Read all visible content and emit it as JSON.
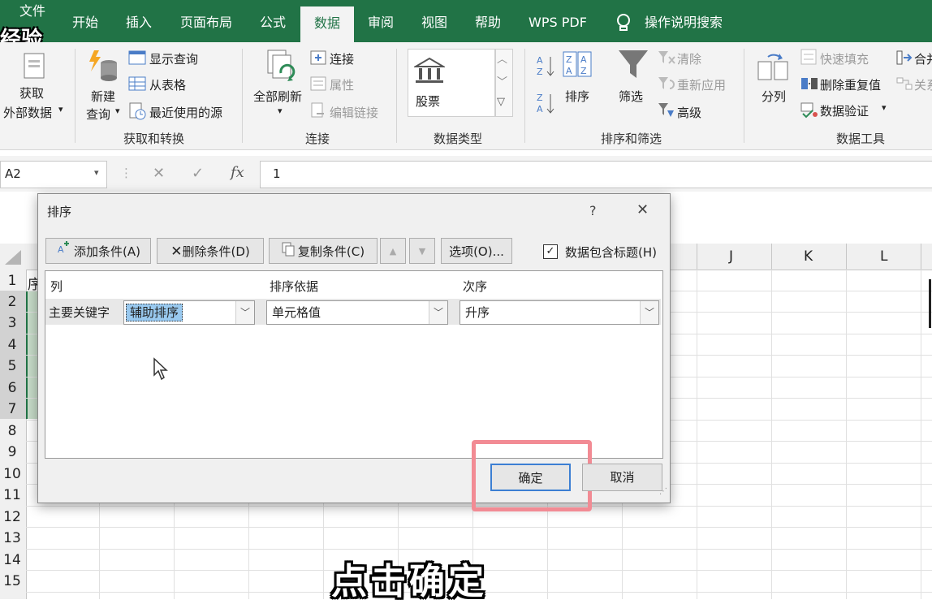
{
  "tabs": [
    {
      "label": "文件"
    },
    {
      "label": "开始"
    },
    {
      "label": "插入"
    },
    {
      "label": "页面布局"
    },
    {
      "label": "公式"
    },
    {
      "label": "数据"
    },
    {
      "label": "审阅"
    },
    {
      "label": "视图"
    },
    {
      "label": "帮助"
    },
    {
      "label": "WPS PDF"
    },
    {
      "label": "操作说明搜索"
    }
  ],
  "watermark": "经验",
  "ribbon": {
    "get_external_1": "获取",
    "get_external_2": "外部数据",
    "new_query_1": "新建",
    "new_query_2": "查询",
    "show_query": "显示查询",
    "from_table": "从表格",
    "recent_sources": "最近使用的源",
    "group_get_transform": "获取和转换",
    "refresh_all": "全部刷新",
    "connections": "连接",
    "properties": "属性",
    "edit_links": "编辑链接",
    "group_connections": "连接",
    "stocks": "股票",
    "group_data_types": "数据类型",
    "sort": "排序",
    "filter": "筛选",
    "clear": "清除",
    "reapply": "重新应用",
    "advanced": "高级",
    "group_sort_filter": "排序和筛选",
    "text_to_columns": "分列",
    "flash_fill": "快速填充",
    "remove_duplicates": "删除重复值",
    "data_validation": "数据验证",
    "consolidate": "合并",
    "relationships": "关系",
    "group_data_tools": "数据工具"
  },
  "formula": {
    "name_box": "A2",
    "fx": "fx",
    "value": "1"
  },
  "sheet": {
    "columns": [
      "J",
      "K",
      "L"
    ],
    "rows": [
      "1",
      "2",
      "3",
      "4",
      "5",
      "6",
      "7",
      "8",
      "9",
      "10",
      "11",
      "12",
      "13",
      "14",
      "15"
    ],
    "a1_partial": "序"
  },
  "dialog": {
    "title": "排序",
    "help": "?",
    "close": "✕",
    "add_condition": "添加条件(A)",
    "delete_condition": "删除条件(D)",
    "copy_condition": "复制条件(C)",
    "options": "选项(O)...",
    "header_checkbox": "数据包含标题(H)",
    "col_header": "列",
    "sort_on_header": "排序依据",
    "order_header": "次序",
    "primary_key": "主要关键字",
    "column_value": "辅助排序",
    "sort_on_value": "单元格值",
    "order_value": "升序",
    "ok": "确定",
    "cancel": "取消"
  },
  "subtitle": "点击确定",
  "colors": {
    "excel_green": "#217346",
    "selection_blue": "#99c9ef",
    "highlight_red": "#f28b94"
  }
}
